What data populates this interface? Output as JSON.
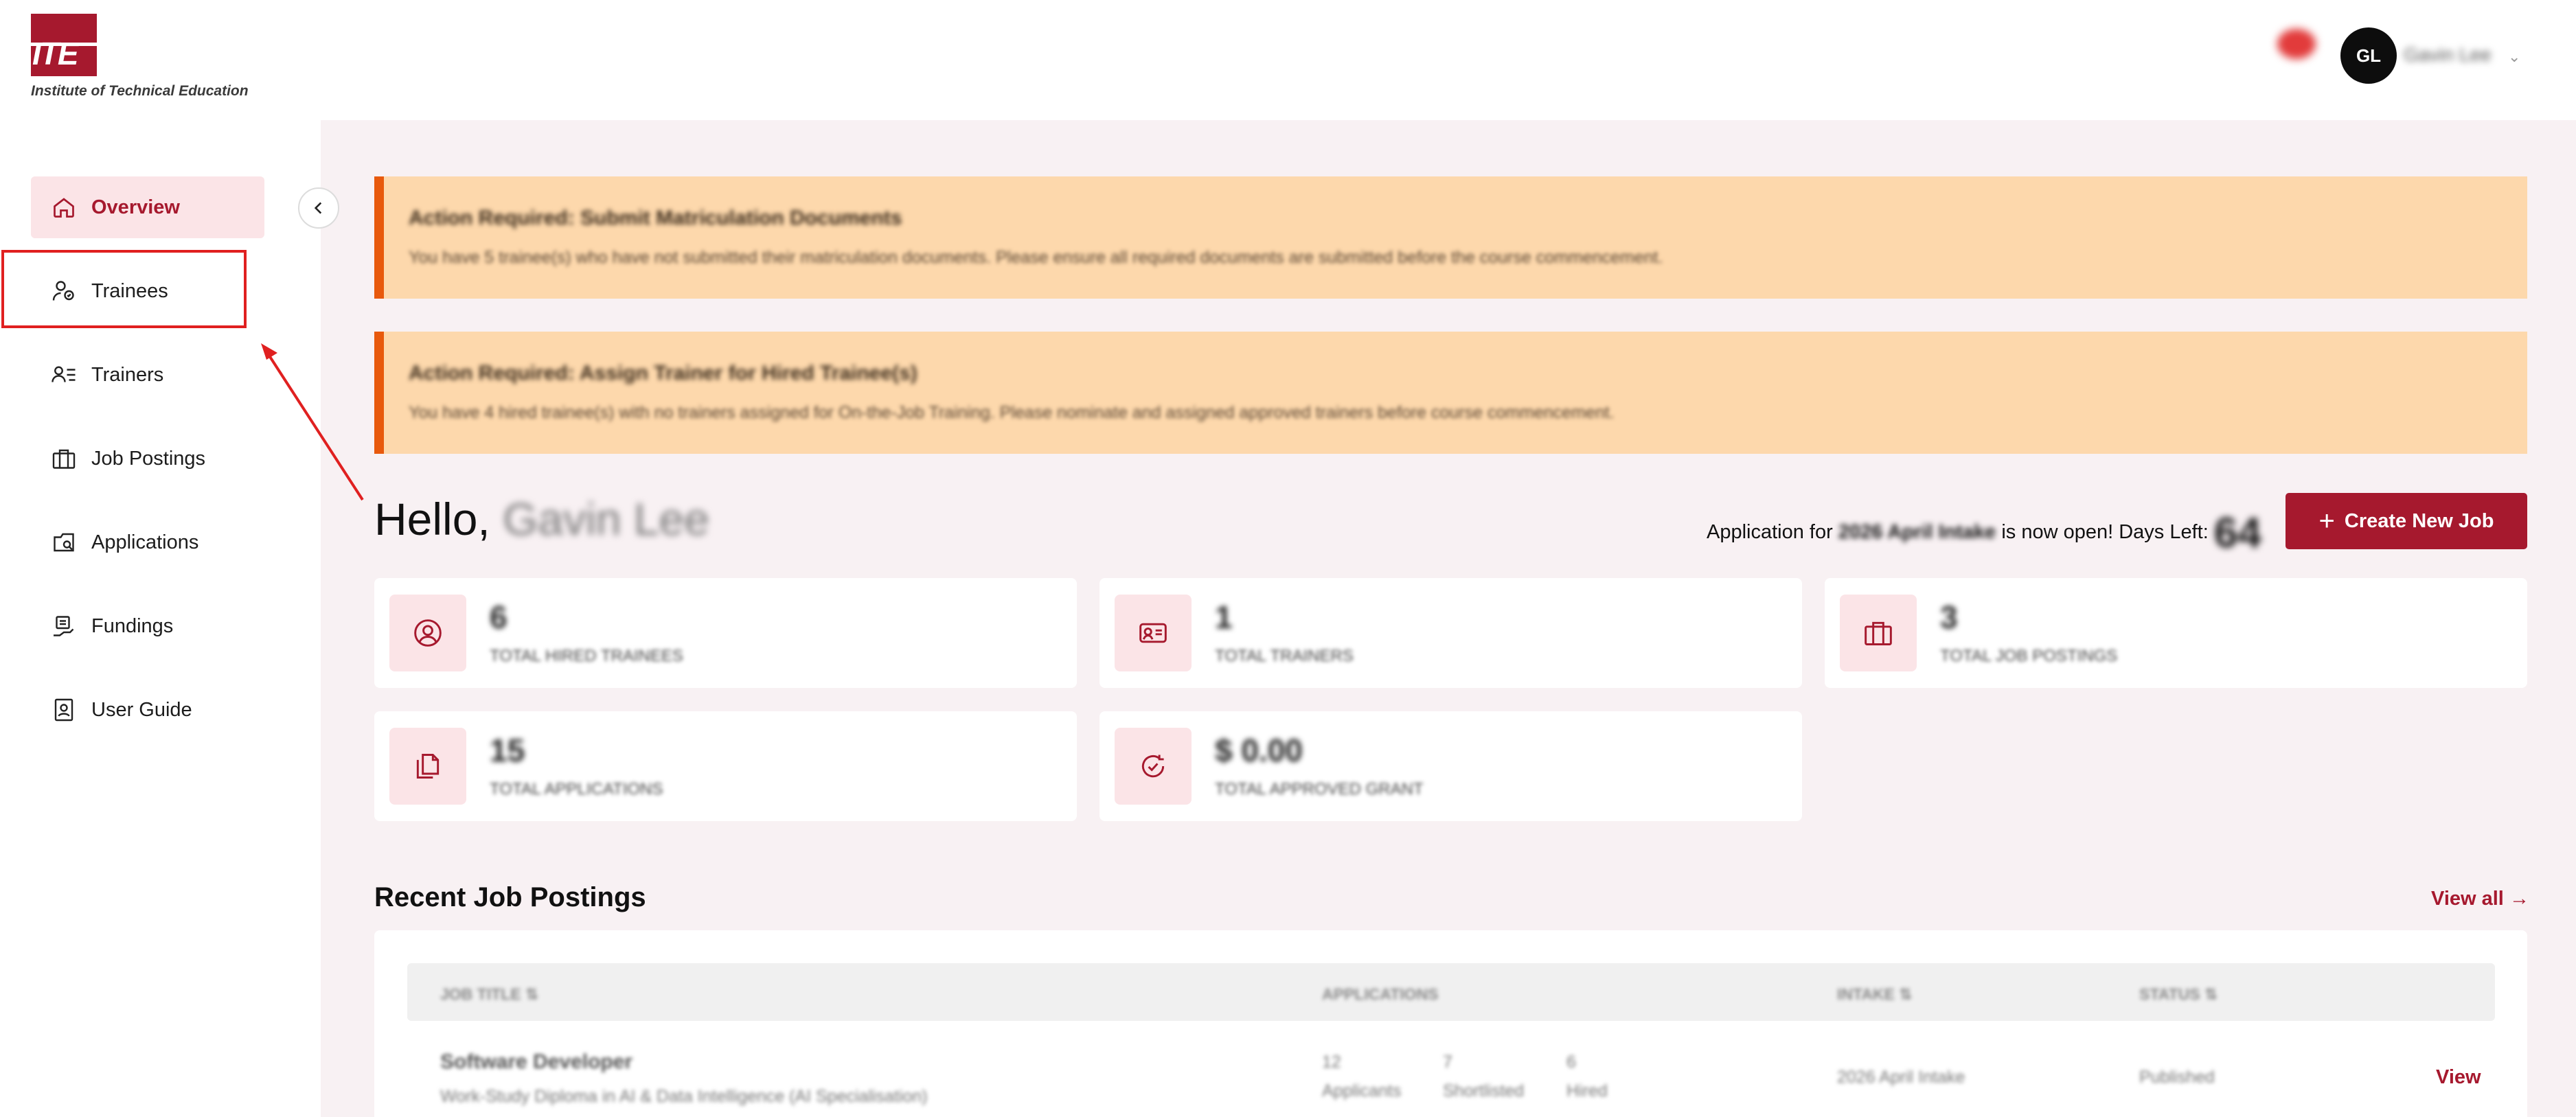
{
  "brand": {
    "logo_text": "ITE",
    "name": "Institute of Technical Education"
  },
  "header": {
    "avatar_initials": "GL",
    "user_name": "Gavin Lee"
  },
  "sidebar": {
    "items": [
      {
        "label": "Overview",
        "icon": "home-icon",
        "active": true
      },
      {
        "label": "Trainees",
        "icon": "trainees-icon",
        "active": false
      },
      {
        "label": "Trainers",
        "icon": "trainers-icon",
        "active": false
      },
      {
        "label": "Job Postings",
        "icon": "briefcase-icon",
        "active": false
      },
      {
        "label": "Applications",
        "icon": "applications-icon",
        "active": false
      },
      {
        "label": "Fundings",
        "icon": "fundings-icon",
        "active": false
      },
      {
        "label": "User Guide",
        "icon": "user-guide-icon",
        "active": false
      }
    ]
  },
  "alerts": [
    {
      "title": "Action Required: Submit Matriculation Documents",
      "body": "You have 5 trainee(s) who have not submitted their matriculation documents. Please ensure all required documents are submitted before the course commencement."
    },
    {
      "title": "Action Required: Assign Trainer for Hired Trainee(s)",
      "body": "You have 4 hired trainee(s) with no trainers assigned for On-the-Job Training. Please nominate and assigned approved trainers before course commencement."
    }
  ],
  "greeting": {
    "prefix": "Hello,",
    "name": "Gavin Lee"
  },
  "intake_note": {
    "prefix": "Application for",
    "intake": "2026 April Intake",
    "middle": "is now open! Days Left:",
    "days_left": "64"
  },
  "create_button": {
    "label": "Create New Job"
  },
  "stats": [
    {
      "value": "6",
      "label": "TOTAL HIRED TRAINEES",
      "icon": "user-circle-icon"
    },
    {
      "value": "1",
      "label": "TOTAL TRAINERS",
      "icon": "id-card-icon"
    },
    {
      "value": "3",
      "label": "TOTAL JOB POSTINGS",
      "icon": "briefcase-icon"
    },
    {
      "value": "15",
      "label": "TOTAL APPLICATIONS",
      "icon": "documents-icon"
    },
    {
      "value": "$ 0.00",
      "label": "TOTAL APPROVED GRANT",
      "icon": "grant-icon"
    }
  ],
  "recent_jobs": {
    "title": "Recent Job Postings",
    "view_all": "View all",
    "columns": [
      "JOB TITLE ⇅",
      "APPLICATIONS",
      "INTAKE ⇅",
      "STATUS ⇅"
    ],
    "rows": [
      {
        "title": "Software Developer",
        "subtitle": "Work-Study Diploma in AI & Data Intelligence (AI Specialisation)",
        "applicants": "12",
        "applicants_label": "Applicants",
        "shortlisted": "7",
        "shortlisted_label": "Shortlisted",
        "hired": "6",
        "hired_label": "Hired",
        "intake": "2026 April Intake",
        "status": "Published",
        "action": "View"
      }
    ]
  },
  "colors": {
    "brand": "#a6192e",
    "alert_bg": "#fdd8ac",
    "alert_accent": "#e8590c",
    "page_bg": "#f8f1f3"
  }
}
